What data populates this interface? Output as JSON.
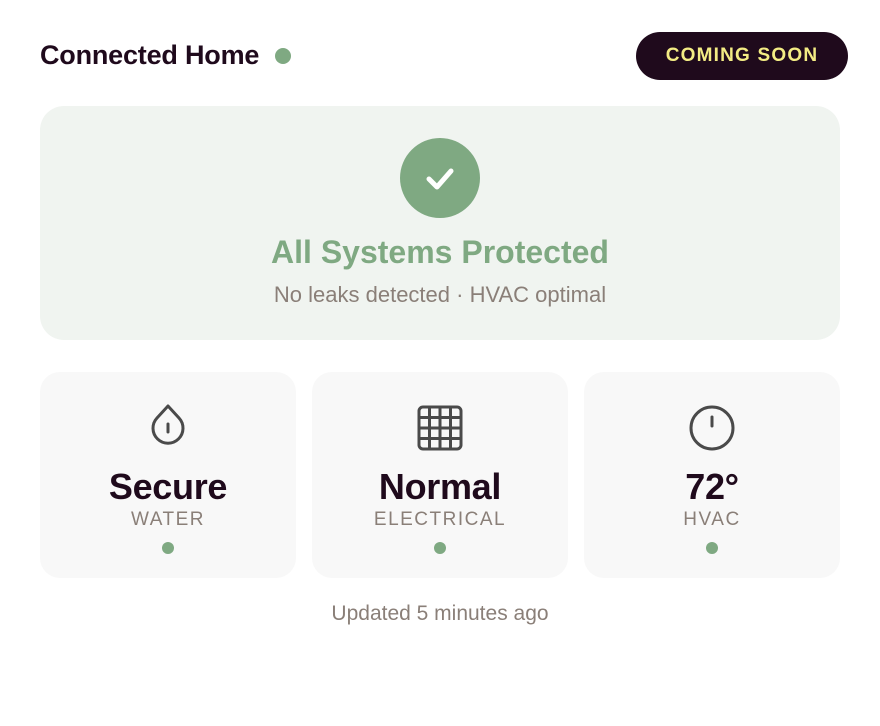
{
  "header": {
    "title": "Connected Home",
    "status_color": "#7fa982",
    "badge": "COMING SOON"
  },
  "hero": {
    "icon": "checkmark-icon",
    "title": "All Systems Protected",
    "subtitle": "No leaks detected · HVAC optimal"
  },
  "cards": [
    {
      "icon": "water-drop-icon",
      "value": "Secure",
      "label": "WATER",
      "status_color": "#7fa982"
    },
    {
      "icon": "grid-panel-icon",
      "value": "Normal",
      "label": "ELECTRICAL",
      "status_color": "#7fa982"
    },
    {
      "icon": "thermostat-icon",
      "value": "72°",
      "label": "HVAC",
      "status_color": "#7fa982"
    }
  ],
  "footer": {
    "updated": "Updated 5 minutes ago"
  },
  "colors": {
    "accent": "#7fa982",
    "dark": "#1f0a1c",
    "badge_text": "#f3ec84",
    "muted": "#8a7f78"
  }
}
